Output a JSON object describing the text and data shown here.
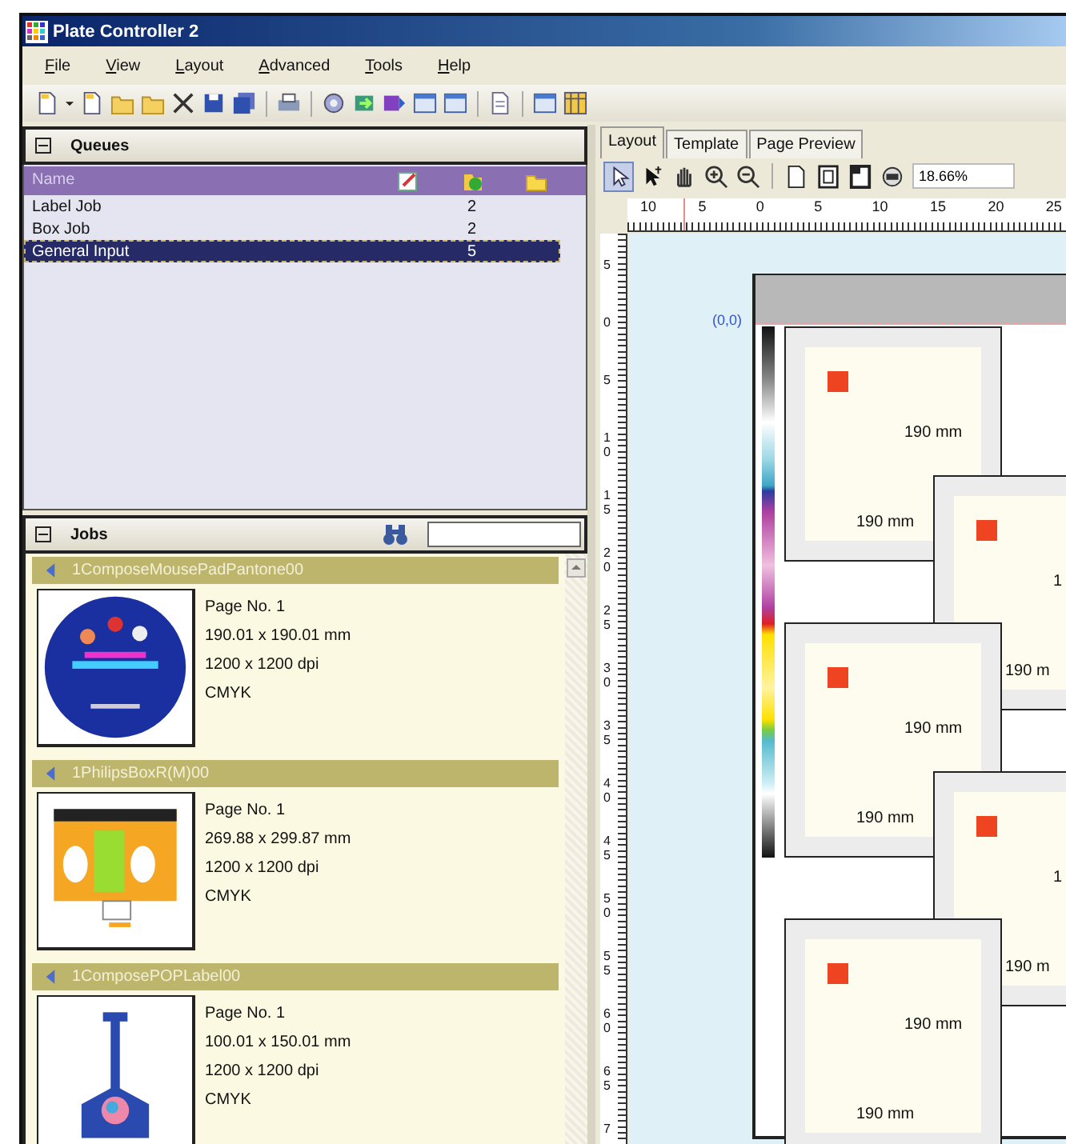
{
  "window": {
    "title": "Plate Controller 2"
  },
  "menu": [
    "File",
    "View",
    "Layout",
    "Advanced",
    "Tools",
    "Help"
  ],
  "queues": {
    "title": "Queues",
    "name_column": "Name",
    "rows": [
      {
        "name": "Label Job",
        "count": "2",
        "selected": false
      },
      {
        "name": "Box Job",
        "count": "2",
        "selected": false
      },
      {
        "name": "General Input",
        "count": "5",
        "selected": true
      }
    ]
  },
  "jobs": {
    "title": "Jobs",
    "items": [
      {
        "name": "1ComposeMousePadPantone00",
        "kind": "disc",
        "page": "Page No. 1",
        "size": "190.01 x 190.01 mm",
        "resolution": "1200 x 1200 dpi",
        "color_mode": "CMYK"
      },
      {
        "name": "1PhilipsBoxR(M)00",
        "kind": "box",
        "page": "Page No. 1",
        "size": "269.88 x 299.87 mm",
        "resolution": "1200 x 1200 dpi",
        "color_mode": "CMYK"
      },
      {
        "name": "1ComposePOPLabel00",
        "kind": "label",
        "page": "Page No. 1",
        "size": "100.01 x 150.01 mm",
        "resolution": "1200 x 1200 dpi",
        "color_mode": "CMYK"
      }
    ]
  },
  "layout": {
    "tabs": [
      {
        "label": "Layout",
        "selected": true
      },
      {
        "label": "Template",
        "selected": false
      },
      {
        "label": "Page Preview",
        "selected": false
      }
    ],
    "zoom": "18.66%",
    "horizontal_ruler": [
      "10",
      "5",
      "0",
      "5",
      "10",
      "15",
      "20",
      "25"
    ],
    "vertical_ruler": [
      "5",
      "0",
      "5",
      "10",
      "15",
      "20",
      "25",
      "30",
      "35",
      "40",
      "45",
      "50",
      "55",
      "60",
      "65",
      "7"
    ],
    "origin": "(0,0)",
    "pages": [
      {
        "width_label": "190 mm",
        "height_label": "190 mm"
      },
      {
        "width_label": "1",
        "height_label": "190 m"
      },
      {
        "width_label": "190 mm",
        "height_label": "190 mm"
      },
      {
        "width_label": "1",
        "height_label": "190 m"
      },
      {
        "width_label": "190 mm",
        "height_label": "190 mm"
      }
    ]
  }
}
